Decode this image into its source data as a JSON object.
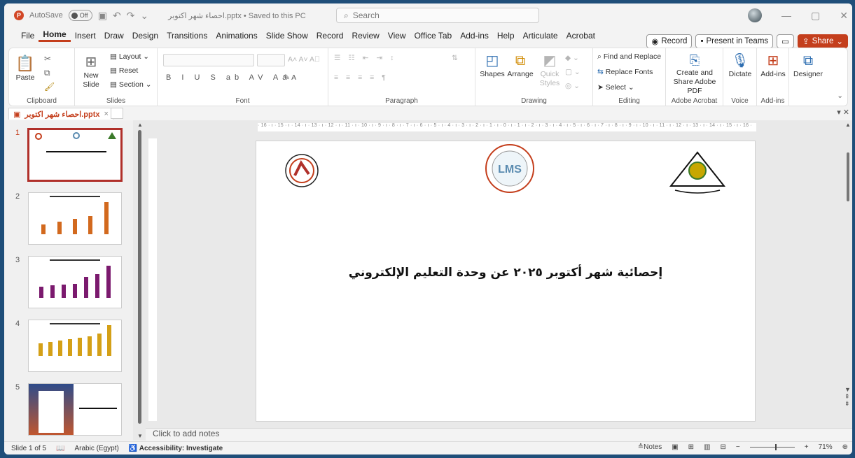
{
  "app": {
    "autosave_label": "AutoSave",
    "autosave_state": "Off",
    "doc_title": "احصاء شهر اكتوبر.pptx • Saved to this PC",
    "search_placeholder": "Search"
  },
  "menu": {
    "items": [
      "File",
      "Home",
      "Insert",
      "Draw",
      "Design",
      "Transitions",
      "Animations",
      "Slide Show",
      "Record",
      "Review",
      "View",
      "Office Tab",
      "Add-ins",
      "Help",
      "Articulate",
      "Acrobat"
    ],
    "active": "Home",
    "record_label": "Record",
    "present_label": "Present in Teams",
    "share_label": "Share"
  },
  "ribbon": {
    "clipboard": {
      "paste": "Paste",
      "label": "Clipboard"
    },
    "slides": {
      "new_slide": "New Slide",
      "layout": "Layout",
      "reset": "Reset",
      "section": "Section",
      "label": "Slides"
    },
    "font": {
      "label": "Font"
    },
    "paragraph": {
      "label": "Paragraph"
    },
    "drawing": {
      "shapes": "Shapes",
      "arrange": "Arrange",
      "quick_styles": "Quick Styles",
      "label": "Drawing"
    },
    "editing": {
      "find_replace": "Find and Replace",
      "replace_fonts": "Replace Fonts",
      "select": "Select",
      "label": "Editing"
    },
    "acrobat": {
      "create_share": "Create and Share Adobe PDF",
      "label": "Adobe Acrobat"
    },
    "voice": {
      "dictate": "Dictate",
      "label": "Voice"
    },
    "addins": {
      "addins": "Add-ins",
      "label": "Add-ins"
    },
    "designer": {
      "designer": "Designer"
    }
  },
  "tab": {
    "filename": "احصاء شهر اكتوبر.pptx"
  },
  "thumbnails": [
    {
      "number": "1"
    },
    {
      "number": "2"
    },
    {
      "number": "3"
    },
    {
      "number": "4"
    },
    {
      "number": "5"
    }
  ],
  "slide": {
    "title": "إحصائية شهر أكتوبر ٢٠٢٥ عن وحدة التعليم الإلكتروني",
    "ruler_text": "· 16 · ı · 15 · ı · 14 · ı · 13 · ı · 12 · ı · 11 · ı · 10 · ı · 9 · ı · 8 · ı · 7 · ı · 6 · ı · 5 · ı · 4 · ı · 3 · ı · 2 · ı · 1 · ı · 0 · ı · 1 · ı · 2 · ı · 3 · ı · 4 · ı · 5 · ı · 6 · ı · 7 · ı · 8 · ı · 9 · ı · 10 · ı · 11 · ı · 12 · ı · 13 · ı · 14 · ı · 15 · ı · 16 ·"
  },
  "notes": {
    "placeholder": "Click to add notes"
  },
  "status": {
    "slide_of": "Slide 1 of 5",
    "language": "Arabic (Egypt)",
    "accessibility": "Accessibility: Investigate",
    "notes": "Notes",
    "zoom": "71%"
  },
  "colors": {
    "accent": "#c43e1c",
    "thumb_orange": "#d2691e",
    "thumb_purple": "#7b1a6e",
    "thumb_gold": "#d4a017"
  }
}
